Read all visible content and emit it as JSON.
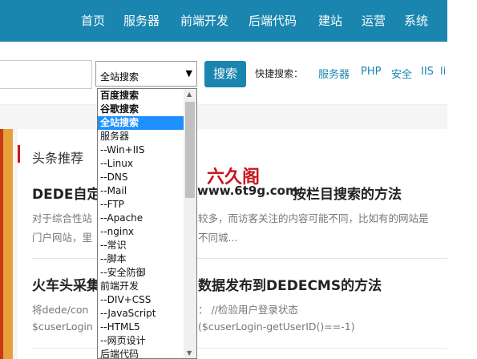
{
  "nav": {
    "items": [
      "首页",
      "服务器",
      "前端开发",
      "后端代码",
      "建站",
      "运营",
      "系统"
    ]
  },
  "search": {
    "selected": "全站搜索",
    "button": "搜索",
    "quick_label": "快捷搜索：",
    "quick_links": [
      "服务器",
      "PHP",
      "安全",
      "IIS",
      "li"
    ]
  },
  "dropdown": {
    "options": [
      "百度搜索",
      "谷歌搜索",
      "全站搜索",
      "服务器",
      "--Win+IIS",
      "--Linux",
      "--DNS",
      "--Mail",
      "--FTP",
      "--Apache",
      "--nginx",
      "--常识",
      "--脚本",
      "--安全防御",
      "前端开发",
      "--DIV+CSS",
      "--JavaScript",
      "--HTML5",
      "--网页设计",
      "后端代码"
    ]
  },
  "section": {
    "title": "头条推荐"
  },
  "brand": {
    "logo_text": "六久阁",
    "overlap_text": "www.6t9g.com"
  },
  "articles": [
    {
      "title_left": "DEDE自定",
      "title_right": "按栏目搜索的方法",
      "text1_left": "对于综合性站",
      "text1_right": "较多，而访客关注的内容可能不同，比如有的网站是",
      "text2_left": "门户网站，里",
      "text2_right": "不同城..."
    },
    {
      "title_left": "火车头采集",
      "title_right": "数据发布到DEDECMS的方法",
      "text1_left": "将dede/con",
      "text1_right": "：  //检验用户登录状态",
      "text2_left": "$cuserLogin",
      "text2_right": "($cuserLogin-getUserID()==-1)"
    }
  ]
}
